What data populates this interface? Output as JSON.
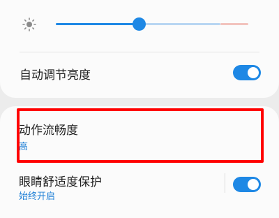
{
  "brightness": {
    "label_cut": "亮度",
    "level": 0.43,
    "icon": "sun-icon"
  },
  "auto_brightness": {
    "label": "自动调节亮度",
    "enabled": true
  },
  "motion_smoothness": {
    "label": "动作流畅度",
    "value": "高",
    "highlighted": true,
    "highlight_color": "#ff0000"
  },
  "eye_comfort": {
    "label": "眼睛舒适度保护",
    "value": "始终开启",
    "enabled": true
  },
  "colors": {
    "accent": "#1e88e5",
    "highlight": "#ff0000"
  }
}
